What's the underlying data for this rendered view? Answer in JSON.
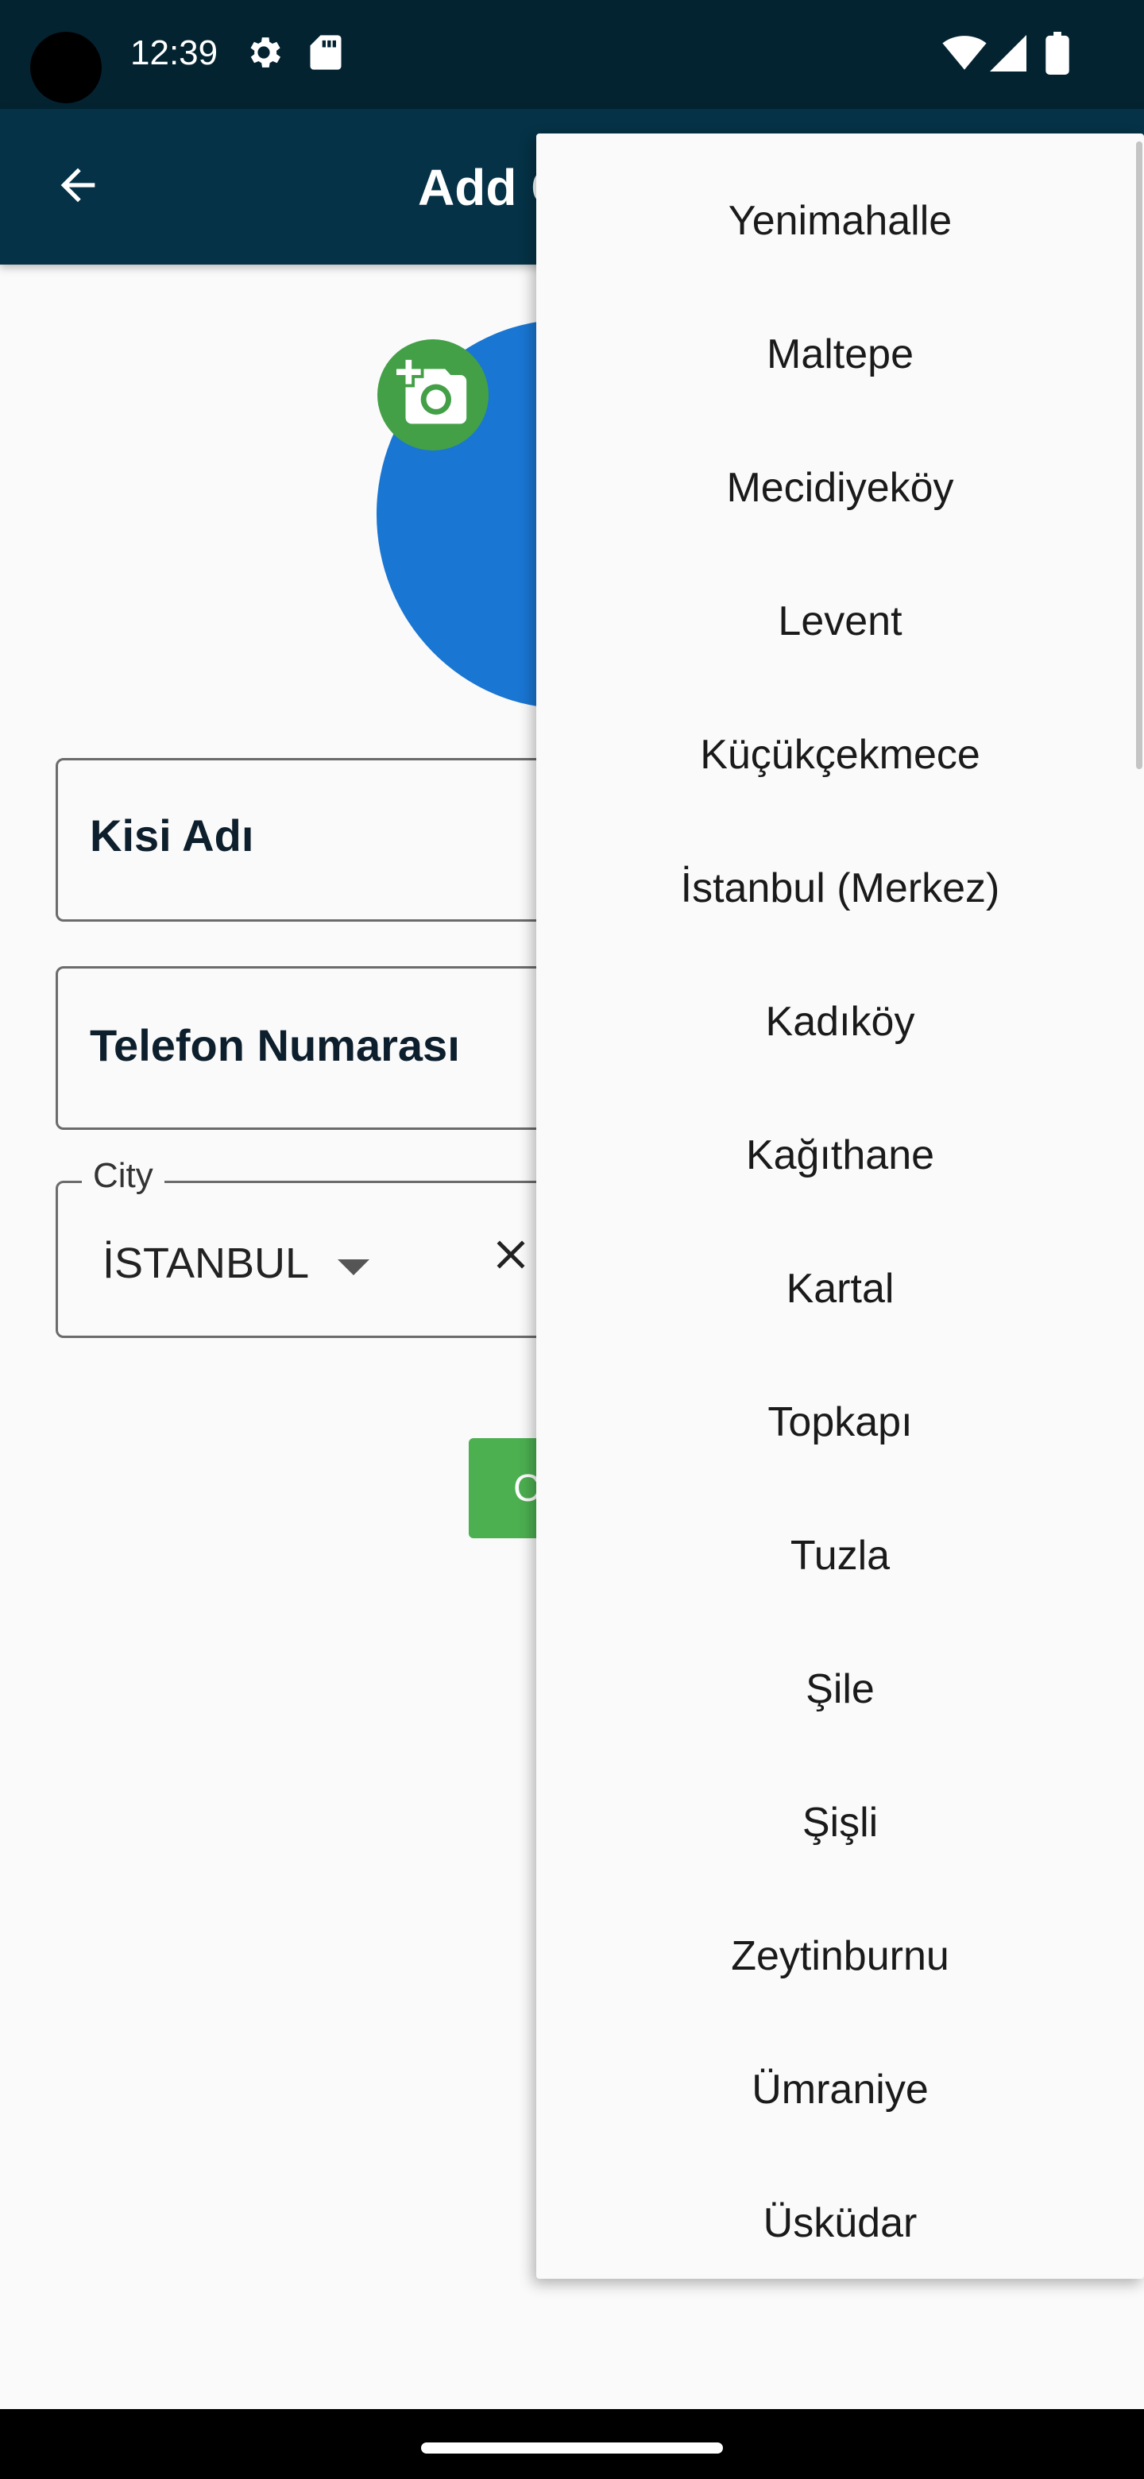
{
  "status_bar": {
    "time": "12:39",
    "icons": [
      "settings-icon",
      "sd-card-icon",
      "wifi-icon",
      "cell-signal-icon",
      "battery-icon"
    ]
  },
  "app_bar": {
    "title": "Add C",
    "back_icon": "arrow-back-icon"
  },
  "form": {
    "contact_name_placeholder": "Kisi Adı",
    "phone_placeholder": "Telefon Numarası",
    "city_label": "City",
    "city_value": "İSTANBUL",
    "save_label": "C"
  },
  "district_menu": {
    "items": [
      "Yenimahalle",
      "Maltepe",
      "Mecidiyeköy",
      "Levent",
      "Küçükçekmece",
      "İstanbul (Merkez)",
      "Kadıköy",
      "Kağıthane",
      "Kartal",
      "Topkapı",
      "Tuzla",
      "Şile",
      "Şişli",
      "Zeytinburnu",
      "Ümraniye",
      "Üsküdar"
    ]
  },
  "colors": {
    "status_bar": "#042331",
    "app_bar": "#053246",
    "avatar": "#1976d2",
    "add_photo": "#43a047",
    "button": "#4caf50",
    "menu_bg": "#fafafa"
  }
}
